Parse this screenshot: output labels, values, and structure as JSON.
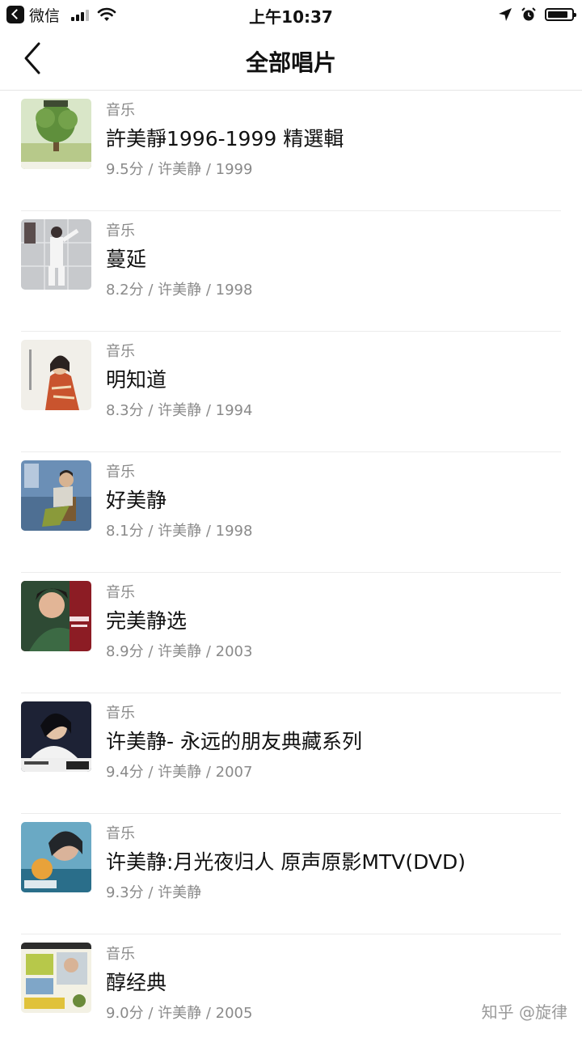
{
  "status_bar": {
    "app_name": "微信",
    "time": "上午10:37"
  },
  "nav": {
    "title": "全部唱片"
  },
  "records": [
    {
      "category": "音乐",
      "title": "許美靜1996-1999 精選輯",
      "info": "9.5分 / 许美静 / 1999"
    },
    {
      "category": "音乐",
      "title": "蔓延",
      "info": "8.2分 / 许美静 / 1998"
    },
    {
      "category": "音乐",
      "title": "明知道",
      "info": "8.3分 / 许美静 / 1994"
    },
    {
      "category": "音乐",
      "title": "好美静",
      "info": "8.1分 / 许美静 / 1998"
    },
    {
      "category": "音乐",
      "title": "完美静选",
      "info": "8.9分 / 许美静 / 2003"
    },
    {
      "category": "音乐",
      "title": "许美静- 永远的朋友典藏系列",
      "info": "9.4分 / 许美静 / 2007"
    },
    {
      "category": "音乐",
      "title": "许美静:月光夜归人 原声原影MTV(DVD)",
      "info": "9.3分 / 许美静"
    },
    {
      "category": "音乐",
      "title": "醇经典",
      "info": "9.0分 / 许美静 / 2005"
    }
  ],
  "watermark": "知乎 @旋律"
}
